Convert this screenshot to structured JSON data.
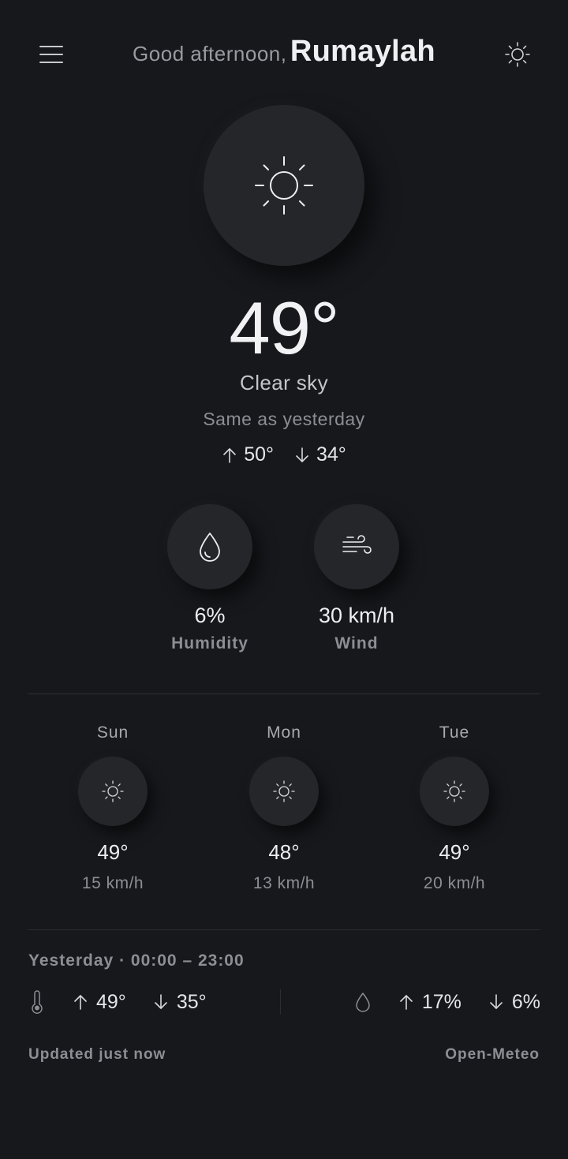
{
  "header": {
    "greeting": "Good afternoon,",
    "user_name": "Rumaylah"
  },
  "current": {
    "temperature": "49°",
    "condition": "Clear sky",
    "comparison": "Same as yesterday",
    "high": "50°",
    "low": "34°",
    "icon": "sun-icon"
  },
  "metrics": [
    {
      "value": "6%",
      "label": "Humidity",
      "icon": "droplet-icon"
    },
    {
      "value": "30 km/h",
      "label": "Wind",
      "icon": "wind-icon"
    }
  ],
  "forecast": [
    {
      "day": "Sun",
      "temp": "49°",
      "wind": "15 km/h",
      "icon": "sun-icon"
    },
    {
      "day": "Mon",
      "temp": "48°",
      "wind": "13 km/h",
      "icon": "sun-icon"
    },
    {
      "day": "Tue",
      "temp": "49°",
      "wind": "20 km/h",
      "icon": "sun-icon"
    }
  ],
  "yesterday": {
    "title": "Yesterday · 00:00 – 23:00",
    "temp_high": "49°",
    "temp_low": "35°",
    "humidity_high": "17%",
    "humidity_low": "6%"
  },
  "footer": {
    "updated": "Updated just now",
    "source": "Open-Meteo"
  },
  "colors": {
    "background": "#17181c",
    "surface": "#25262a",
    "text_primary": "#eeeef1",
    "text_muted": "#8d8e93"
  }
}
